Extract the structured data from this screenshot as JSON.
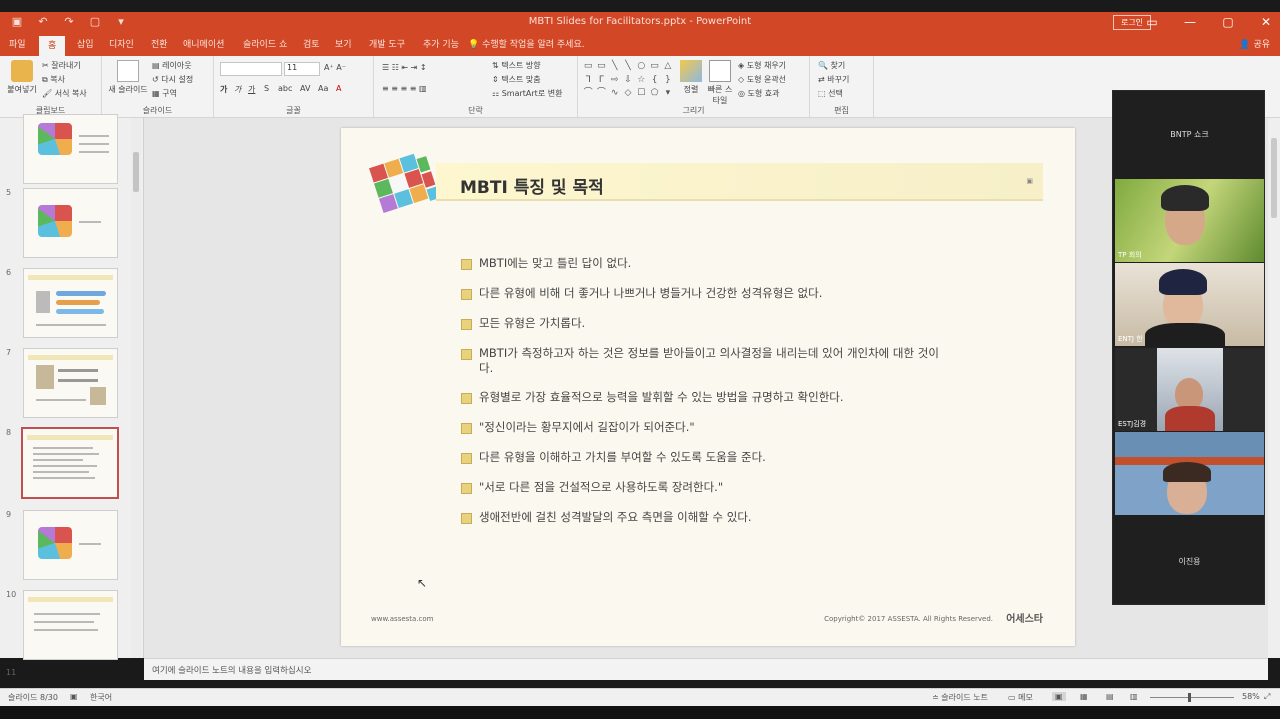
{
  "window": {
    "title": "MBTI Slides for Facilitators.pptx  -  PowerPoint",
    "login_label": "로그인"
  },
  "tabs": [
    "파일",
    "홈",
    "삽입",
    "디자인",
    "전환",
    "애니메이션",
    "슬라이드 쇼",
    "검토",
    "보기",
    "개발 도구",
    "추가 기능"
  ],
  "active_tab": "홈",
  "tell_me": "수행할 작업을 알려 주세요.",
  "share": "공유",
  "ribbon": {
    "clipboard": {
      "paste": "붙여넣기",
      "cut": "잘라내기",
      "copy": "복사",
      "format_painter": "서식 복사",
      "label": "클립보드"
    },
    "slides": {
      "new_slide": "새 슬라이드",
      "layout": "레이아웃",
      "reset": "다시 설정",
      "section": "구역",
      "label": "슬라이드"
    },
    "font": {
      "label": "글꼴",
      "font_size": "11"
    },
    "paragraph": {
      "label": "단락",
      "text_direction": "텍스트 방향",
      "align_text": "텍스트 맞춤",
      "smartart": "SmartArt로 변환"
    },
    "drawing": {
      "label": "그리기",
      "arrange": "정렬",
      "quick_styles": "빠른 스타일",
      "shape_fill": "도형 채우기",
      "shape_outline": "도형 윤곽선",
      "shape_effects": "도형 효과"
    },
    "editing": {
      "label": "편집",
      "find": "찾기",
      "replace": "바꾸기",
      "select": "선택"
    }
  },
  "thumbnails": [
    {
      "num": "",
      "selected": false
    },
    {
      "num": "5",
      "selected": false
    },
    {
      "num": "6",
      "selected": false
    },
    {
      "num": "7",
      "selected": false
    },
    {
      "num": "8",
      "selected": true
    },
    {
      "num": "9",
      "selected": false
    },
    {
      "num": "10",
      "selected": false
    },
    {
      "num": "11",
      "selected": false
    }
  ],
  "slide": {
    "title": "MBTI 특징 및 목적",
    "bullets": [
      "MBTI에는 맞고 틀린 답이 없다.",
      "다른 유형에 비해 더 좋거나 나쁘거나 병들거나 건강한 성격유형은 없다.",
      "모든 유형은 가치롭다.",
      "MBTI가 측정하고자 하는 것은 정보를 받아들이고 의사결정을 내리는데 있어 개인차에 대한 것이다.",
      "유형별로 가장 효율적으로 능력을 발휘할 수 있는 방법을 규명하고 확인한다.",
      "\"정신이라는 황무지에서 길잡이가 되어준다.\"",
      "다른 유형을 이해하고 가치를 부여할 수 있도록 도움을 준다.",
      "\"서로 다른 점을 건설적으로 사용하도록 장려한다.\"",
      "생애전반에 걸친 성격발달의 주요 측면을 이해할 수 있다."
    ],
    "footer_url": "www.assesta.com",
    "copyright": "Copyright© 2017 ASSESTA. All Rights Reserved.",
    "footer_logo": "어세스타"
  },
  "video": {
    "host": "BNTP 쇼크",
    "tiles": [
      {
        "label": "TP 회의"
      },
      {
        "label": "ENTJ 한"
      },
      {
        "label": "ESTJ김경"
      },
      {
        "label": ""
      }
    ],
    "bottom_name": "이진용"
  },
  "notes_placeholder": "여기에 슬라이드 노트의 내용을 입력하십시오",
  "status": {
    "slide_info": "슬라이드 8/30",
    "language": "한국어",
    "notes_btn": "슬라이드 노트",
    "comments_btn": "메모",
    "zoom": "58%"
  },
  "colors": {
    "accent": "#d24726",
    "bullet": "#e9d27c",
    "banner": "#fdf6cf"
  }
}
